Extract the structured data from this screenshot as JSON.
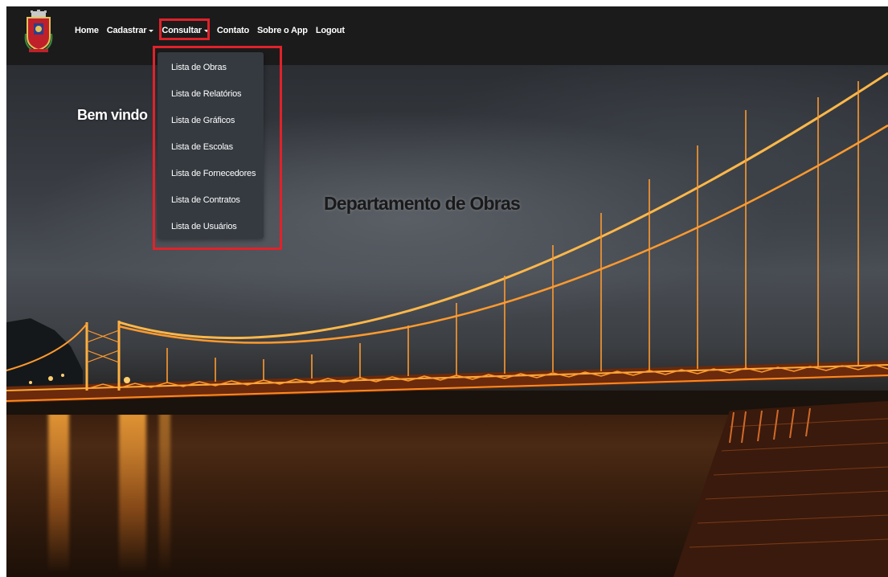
{
  "navbar": {
    "logo_icon": "municipal-coat-of-arms-icon",
    "items": [
      {
        "label": "Home",
        "dropdown": false
      },
      {
        "label": "Cadastrar",
        "dropdown": true
      },
      {
        "label": "Consultar",
        "dropdown": true
      },
      {
        "label": "Contato",
        "dropdown": false
      },
      {
        "label": "Sobre o App",
        "dropdown": false
      },
      {
        "label": "Logout",
        "dropdown": false
      }
    ]
  },
  "dropdown": {
    "items": [
      {
        "label": "Lista de Obras"
      },
      {
        "label": "Lista de Relatórios"
      },
      {
        "label": "Lista de Gráficos"
      },
      {
        "label": "Lista de Escolas"
      },
      {
        "label": "Lista de Fornecedores"
      },
      {
        "label": "Lista de Contratos"
      },
      {
        "label": "Lista de Usuários"
      }
    ]
  },
  "hero": {
    "welcome": "Bem vindo",
    "title": "Departamento de Obras",
    "background_image": "suspension-bridge-at-night"
  },
  "colors": {
    "navbar_bg": "#1b1b1b",
    "dropdown_bg": "#343a40",
    "highlight": "#e0222a",
    "bridge_light": "#ff9a2e"
  }
}
